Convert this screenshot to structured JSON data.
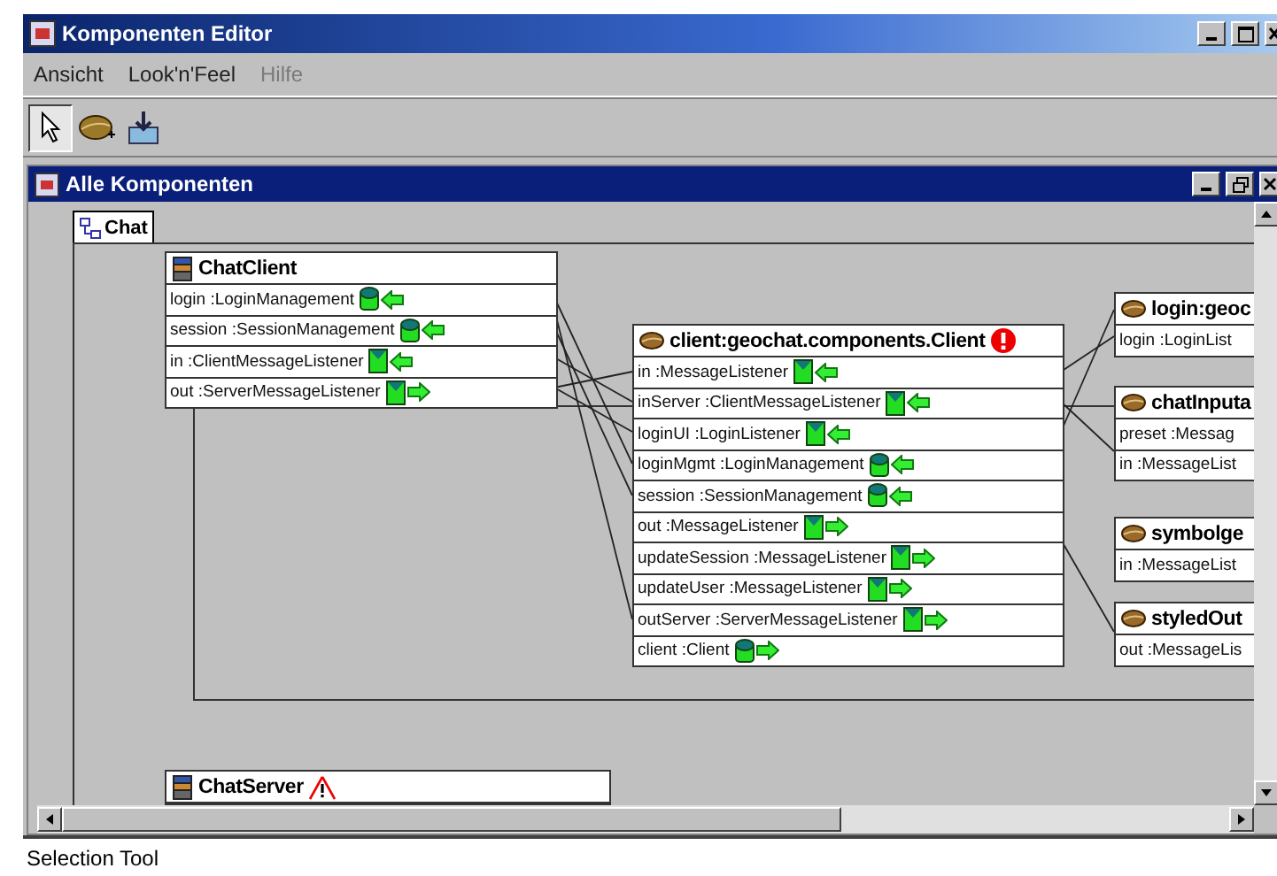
{
  "window": {
    "title": "Komponenten Editor"
  },
  "menu": [
    {
      "label": "Ansicht",
      "disabled": false
    },
    {
      "label": "Look'n'Feel",
      "disabled": false
    },
    {
      "label": "Hilfe",
      "disabled": true
    }
  ],
  "toolbar": [
    {
      "kind": "pointer",
      "selected": true
    },
    {
      "kind": "bean",
      "selected": false
    },
    {
      "kind": "deploy",
      "selected": false
    }
  ],
  "frame": {
    "title": "Alle Komponenten"
  },
  "tabs": [
    {
      "label": "Chat",
      "selected": true
    }
  ],
  "components": [
    {
      "name": "ChatClient",
      "kind": "composite",
      "error": false,
      "warning": false,
      "ports": [
        {
          "label": "login :LoginManagement",
          "kind": "cylinder-in"
        },
        {
          "label": "session :SessionManagement",
          "kind": "cylinder-in"
        },
        {
          "label": "in :ClientMessageListener",
          "kind": "listener-in"
        },
        {
          "label": "out :ServerMessageListener",
          "kind": "listener-out"
        }
      ]
    },
    {
      "name": "client:geochat.components.Client",
      "kind": "bean",
      "error": true,
      "warning": false,
      "ports": [
        {
          "label": "in :MessageListener",
          "kind": "listener-in"
        },
        {
          "label": "inServer :ClientMessageListener",
          "kind": "listener-in"
        },
        {
          "label": "loginUI :LoginListener",
          "kind": "listener-in"
        },
        {
          "label": "loginMgmt :LoginManagement",
          "kind": "cylinder-in"
        },
        {
          "label": "session :SessionManagement",
          "kind": "cylinder-in"
        },
        {
          "label": "out :MessageListener",
          "kind": "listener-out"
        },
        {
          "label": "updateSession :MessageListener",
          "kind": "listener-out"
        },
        {
          "label": "updateUser :MessageListener",
          "kind": "listener-out"
        },
        {
          "label": "outServer :ServerMessageListener",
          "kind": "listener-out"
        },
        {
          "label": "client :Client",
          "kind": "cylinder-out"
        }
      ]
    },
    {
      "name": "login:geoc",
      "kind": "bean",
      "ports": [
        {
          "label": "login :LoginList",
          "kind": "plain"
        }
      ]
    },
    {
      "name": "chatInputa",
      "kind": "bean",
      "ports": [
        {
          "label": "preset :Messag",
          "kind": "plain"
        },
        {
          "label": "in :MessageList",
          "kind": "plain"
        }
      ]
    },
    {
      "name": "symbolge",
      "kind": "bean",
      "ports": [
        {
          "label": "in :MessageList",
          "kind": "plain"
        }
      ]
    },
    {
      "name": "styledOut",
      "kind": "bean",
      "ports": [
        {
          "label": "out :MessageLis",
          "kind": "plain"
        }
      ]
    },
    {
      "name": "ChatServer",
      "kind": "composite",
      "error": false,
      "warning": true
    }
  ],
  "status_bar": "Selection Tool"
}
